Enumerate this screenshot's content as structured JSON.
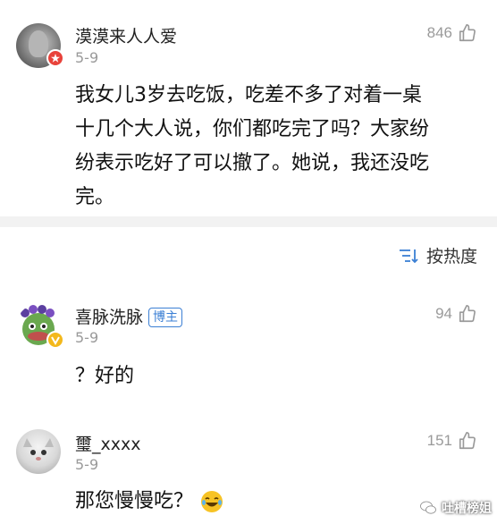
{
  "comments": [
    {
      "username": "漠漠来人人爱",
      "date": "5-9",
      "likes": "846",
      "lines": [
        "我女儿3岁去吃饭，吃差不多了对着一桌",
        "十几个大人说，你们都吃完了吗？大家纷",
        "纷表示吃好了可以撤了。她说，我还没吃",
        "完。"
      ]
    },
    {
      "username": "喜脉洗脉",
      "tag": "博主",
      "date": "5-9",
      "likes": "94",
      "text": "？好的"
    },
    {
      "username": "璽_xxxx",
      "date": "5-9",
      "likes": "151",
      "text": "那您慢慢吃？"
    }
  ],
  "sort": {
    "label": "按热度",
    "icon": "sort-icon"
  },
  "watermark": {
    "text": "吐槽榜姐"
  },
  "colors": {
    "accent": "#3b7fd4",
    "vip_red": "#e8423a",
    "vip_yellow": "#f3b81c",
    "muted": "#9a9a9a"
  }
}
